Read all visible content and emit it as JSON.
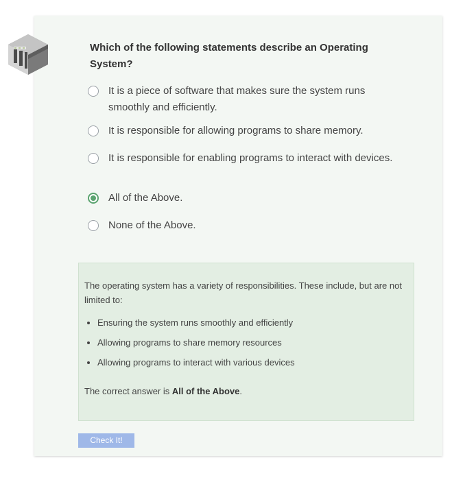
{
  "quiz": {
    "question": "Which of the following statements describe an Operating System?",
    "options": [
      {
        "label": "It is a piece of software that makes sure the system runs smoothly and efficiently.",
        "selected": false
      },
      {
        "label": "It is responsible for allowing programs to share memory.",
        "selected": false
      },
      {
        "label": "It is responsible for enabling programs to interact with devices.",
        "selected": false
      },
      {
        "label": "All of the Above.",
        "selected": true
      },
      {
        "label": "None of the Above.",
        "selected": false
      }
    ],
    "feedback": {
      "intro": "The operating system has a variety of responsibilities. These include, but are not limited to:",
      "bullets": [
        "Ensuring the system runs smoothly and efficiently",
        "Allowing programs to share memory resources",
        "Allowing programs to interact with various devices"
      ],
      "answer_prefix": "The correct answer is ",
      "answer_value": "All of the Above",
      "answer_suffix": "."
    },
    "check_button_label": "Check It!"
  },
  "logo": {
    "icon": "server-rack-icon"
  },
  "colors": {
    "card_background": "#f3f7f3",
    "feedback_background": "#e3eee3",
    "selected_radio": "#5aa36f",
    "button_background": "#9fb8e8"
  }
}
